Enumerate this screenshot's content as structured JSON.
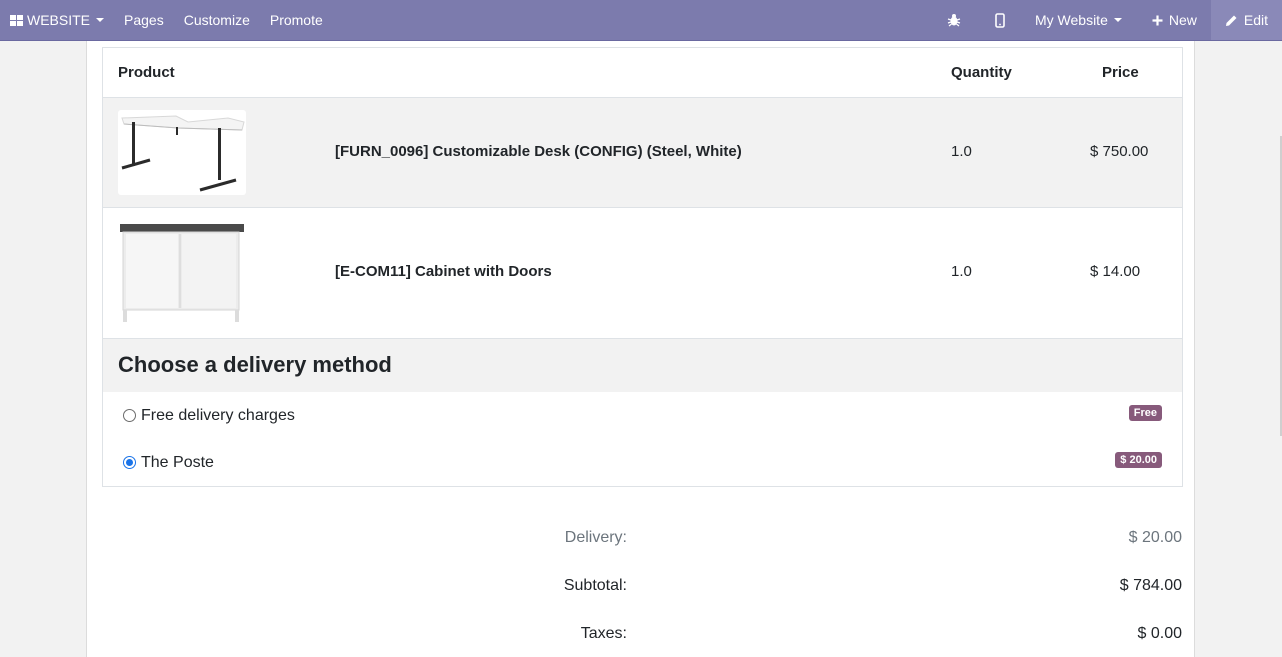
{
  "topbar": {
    "website_label": "WEBSITE",
    "menu": [
      "Pages",
      "Customize",
      "Promote"
    ],
    "my_website": "My Website",
    "new_label": "New",
    "edit_label": "Edit"
  },
  "table": {
    "headers": {
      "product": "Product",
      "quantity": "Quantity",
      "price": "Price"
    },
    "rows": [
      {
        "name": "[FURN_0096] Customizable Desk (CONFIG) (Steel, White)",
        "quantity": "1.0",
        "price": "$ 750.00"
      },
      {
        "name": "[E-COM11] Cabinet with Doors",
        "quantity": "1.0",
        "price": "$ 14.00"
      }
    ]
  },
  "delivery": {
    "title": "Choose a delivery method",
    "options": [
      {
        "label": "Free delivery charges",
        "badge": "Free",
        "checked": false
      },
      {
        "label": "The Poste",
        "badge": "$ 20.00",
        "checked": true
      }
    ]
  },
  "totals": {
    "delivery_label": "Delivery:",
    "delivery_value": "$ 20.00",
    "subtotal_label": "Subtotal:",
    "subtotal_value": "$ 784.00",
    "taxes_label": "Taxes:",
    "taxes_value": "$ 0.00"
  },
  "colors": {
    "topbar": "#7c7bad",
    "badge": "#875a7b",
    "radio_accent": "#1a73e8"
  }
}
